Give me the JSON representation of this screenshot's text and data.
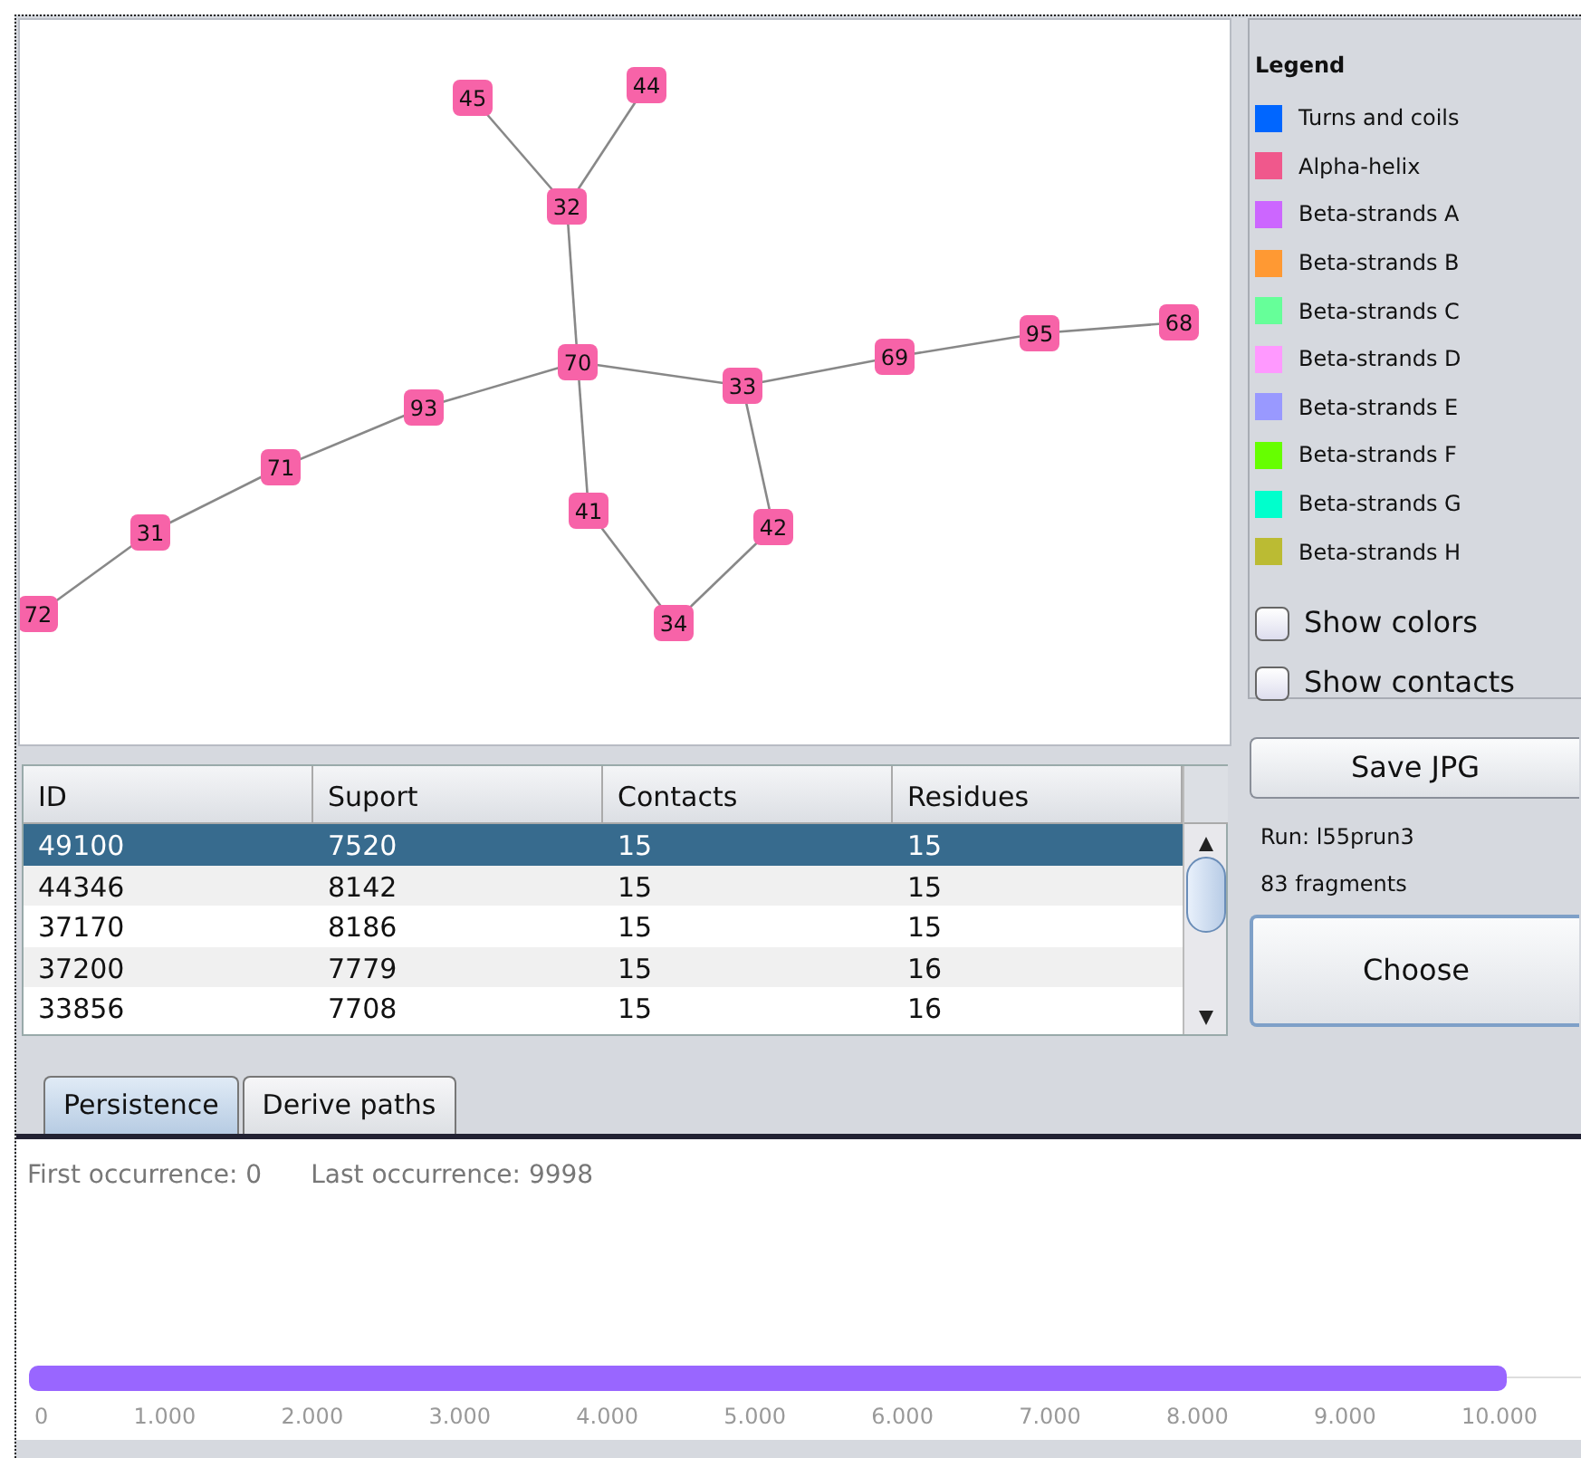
{
  "graph": {
    "nodes": [
      "45",
      "44",
      "32",
      "70",
      "33",
      "69",
      "95",
      "68",
      "93",
      "71",
      "31",
      "72",
      "41",
      "42",
      "34"
    ]
  },
  "legend": {
    "title": "Legend",
    "items": [
      {
        "label": "Turns and coils",
        "color": "#0066ff"
      },
      {
        "label": "Alpha-helix",
        "color": "#f0588c"
      },
      {
        "label": "Beta-strands A",
        "color": "#cc66ff"
      },
      {
        "label": "Beta-strands B",
        "color": "#ff9933"
      },
      {
        "label": "Beta-strands C",
        "color": "#66ff99"
      },
      {
        "label": "Beta-strands D",
        "color": "#ff99ff"
      },
      {
        "label": "Beta-strands E",
        "color": "#9999ff"
      },
      {
        "label": "Beta-strands F",
        "color": "#66ff00"
      },
      {
        "label": "Beta-strands G",
        "color": "#00ffcc"
      },
      {
        "label": "Beta-strands H",
        "color": "#bbbb33"
      }
    ],
    "checkboxes": [
      {
        "label": "Show colors",
        "checked": false
      },
      {
        "label": "Show contacts",
        "checked": false
      }
    ]
  },
  "table": {
    "columns": [
      "ID",
      "Suport",
      "Contacts",
      "Residues"
    ],
    "rows": [
      {
        "cells": [
          "49100",
          "7520",
          "15",
          "15"
        ],
        "selected": true
      },
      {
        "cells": [
          "44346",
          "8142",
          "15",
          "15"
        ],
        "selected": false
      },
      {
        "cells": [
          "37170",
          "8186",
          "15",
          "15"
        ],
        "selected": false
      },
      {
        "cells": [
          "37200",
          "7779",
          "15",
          "16"
        ],
        "selected": false
      },
      {
        "cells": [
          "33856",
          "7708",
          "15",
          "16"
        ],
        "selected": false
      }
    ]
  },
  "save_button": "Save JPG",
  "run_label": "Run:",
  "run_value": "l55prun3",
  "fragments": "83 fragments",
  "choose_button": "Choose",
  "tabs": [
    {
      "label": "Persistence",
      "selected": true
    },
    {
      "label": "Derive paths",
      "selected": false
    }
  ],
  "persistence": {
    "first": "First occurrence: 0",
    "last": "Last occurrence: 9998",
    "level": 0.951,
    "ticks": [
      "0",
      "1.000",
      "2.000",
      "3.000",
      "4.000",
      "5.000",
      "6.000",
      "7.000",
      "8.000",
      "9.000",
      "10.000"
    ]
  }
}
